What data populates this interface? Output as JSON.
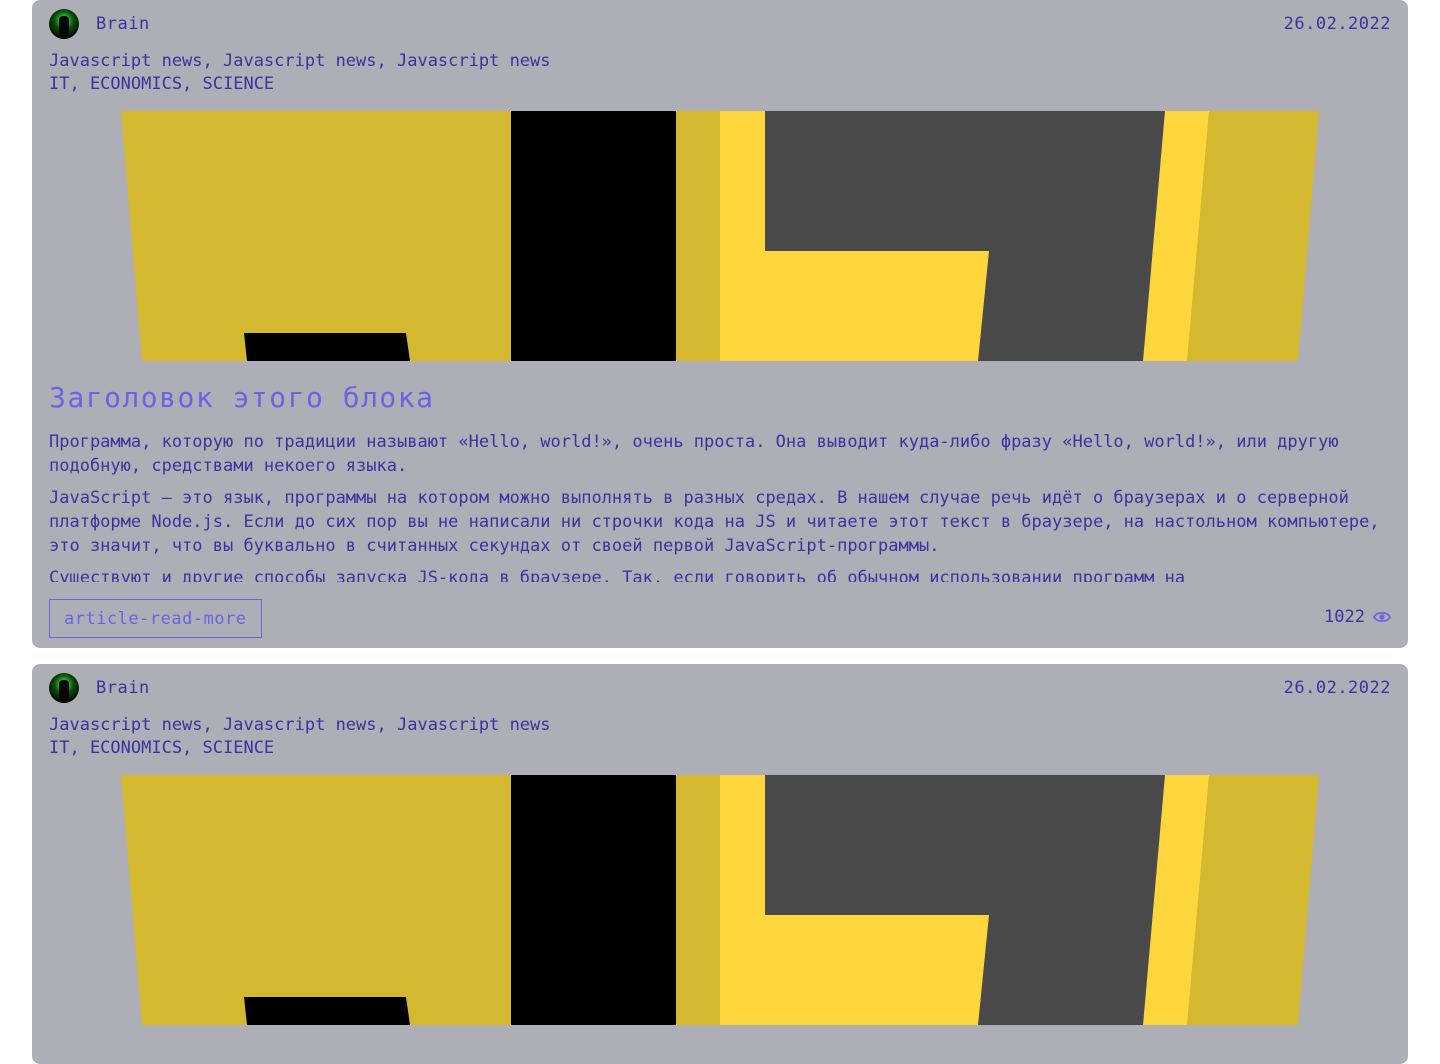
{
  "articles": [
    {
      "author": "Brain",
      "date": "26.02.2022",
      "tags": "Javascript news, Javascript news, Javascript news",
      "categories": "IT, ECONOMICS, SCIENCE",
      "title": "Заголовок этого блока",
      "paragraphs": [
        "Программа, которую по традиции называют «Hello, world!», очень проста. Она выводит куда-либо фразу «Hello, world!», или другую подобную, средствами некоего языка.",
        "JavaScript — это язык, программы на котором можно выполнять в разных средах. В нашем случае речь идёт о браузерах и о серверной платформе Node.js. Если до сих пор вы не написали ни строчки кода на JS и читаете этот текст в браузере, на настольном компьютере, это значит, что вы буквально в считанных секундах от своей первой JavaScript-программы.",
        "Существуют и другие способы запуска JS-кода в браузере. Так, если говорить об обычном использовании программ на"
      ],
      "read_more_label": "article-read-more",
      "views": "1022",
      "icons": {
        "avatar": "avatar-icon",
        "views": "eye-icon"
      }
    },
    {
      "author": "Brain",
      "date": "26.02.2022",
      "tags": "Javascript news, Javascript news, Javascript news",
      "categories": "IT, ECONOMICS, SCIENCE"
    }
  ],
  "colors": {
    "card_bg": "#aeaeb6",
    "text": "#3a33a0",
    "accent": "#6a63e2",
    "cover_yellow": "#d4b82f",
    "cover_bright_yellow": "#fdd63b",
    "cover_black": "#000000",
    "cover_gray": "#4a4a4a"
  }
}
